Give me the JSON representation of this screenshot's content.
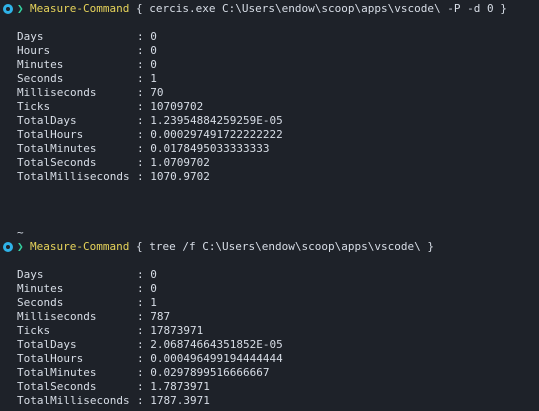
{
  "terminal": {
    "block1": {
      "cmdlet": "Measure-Command",
      "args": " { cercis.exe C:\\Users\\endow\\scoop\\apps\\vscode\\ -P -d 0 }",
      "rows": [
        {
          "key": "Days",
          "value": ": 0"
        },
        {
          "key": "Hours",
          "value": ": 0"
        },
        {
          "key": "Minutes",
          "value": ": 0"
        },
        {
          "key": "Seconds",
          "value": ": 1"
        },
        {
          "key": "Milliseconds",
          "value": ": 70"
        },
        {
          "key": "Ticks",
          "value": ": 10709702"
        },
        {
          "key": "TotalDays",
          "value": ": 1.23954884259259E-05"
        },
        {
          "key": "TotalHours",
          "value": ": 0.000297491722222222"
        },
        {
          "key": "TotalMinutes",
          "value": ": 0.0178495033333333"
        },
        {
          "key": "TotalSeconds",
          "value": ": 1.0709702"
        },
        {
          "key": "TotalMilliseconds",
          "value": ": 1070.9702"
        }
      ]
    },
    "tilde": "~",
    "block2": {
      "cmdlet": "Measure-Command",
      "args": " { tree /f C:\\Users\\endow\\scoop\\apps\\vscode\\ }",
      "rows": [
        {
          "key": "Days",
          "value": ": 0"
        },
        {
          "key": "Minutes",
          "value": ": 0"
        },
        {
          "key": "Seconds",
          "value": ": 1"
        },
        {
          "key": "Milliseconds",
          "value": ": 787"
        },
        {
          "key": "Ticks",
          "value": ": 17873971"
        },
        {
          "key": "TotalDays",
          "value": ": 2.06874664351852E-05"
        },
        {
          "key": "TotalHours",
          "value": ": 0.000496499194444444"
        },
        {
          "key": "TotalMinutes",
          "value": ": 0.0297899516666667"
        },
        {
          "key": "TotalSeconds",
          "value": ": 1.7873971"
        },
        {
          "key": "TotalMilliseconds",
          "value": ": 1787.3971"
        }
      ]
    },
    "colors": {
      "background": "#1e2229",
      "text": "#d7dde6",
      "cmdlet": "#e6d35a",
      "prompt_arrow": "#35d3a0",
      "prompt_dot": "#2fb3e8"
    },
    "icons": {
      "prompt_status": "circle-status-icon",
      "prompt_arrow": "chevron-right-icon"
    }
  }
}
